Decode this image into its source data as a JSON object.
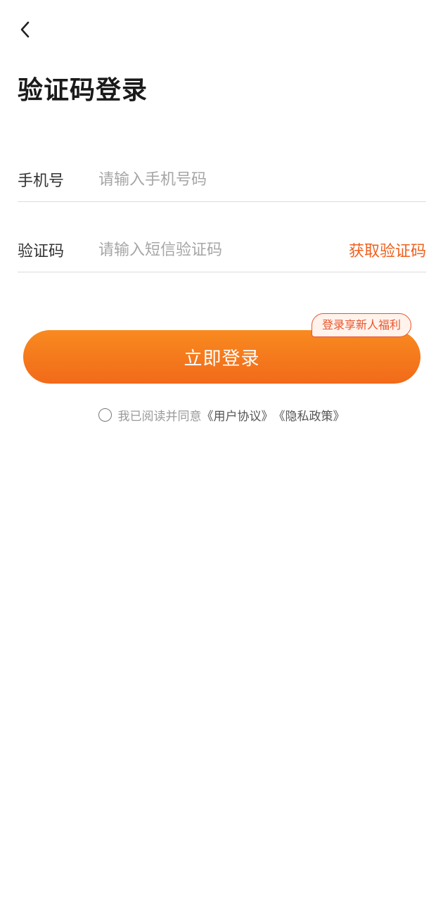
{
  "header": {
    "title": "验证码登录",
    "back_icon": "chevron-left-icon"
  },
  "form": {
    "phone": {
      "label": "手机号",
      "placeholder": "请输入手机号码",
      "value": ""
    },
    "code": {
      "label": "验证码",
      "placeholder": "请输入短信验证码",
      "value": "",
      "get_code_label": "获取验证码"
    }
  },
  "login": {
    "label": "立即登录",
    "badge": "登录享新人福利"
  },
  "agreement": {
    "checked": false,
    "prefix": "我已阅读并同意",
    "user_agreement": "《用户协议》",
    "privacy_policy": "《隐私政策》"
  },
  "colors": {
    "accent": "#f0601e",
    "button_gradient_start": "#f88a1f",
    "button_gradient_end": "#f26a1a",
    "divider": "#dcdcdc",
    "placeholder": "#a6a6a6"
  }
}
